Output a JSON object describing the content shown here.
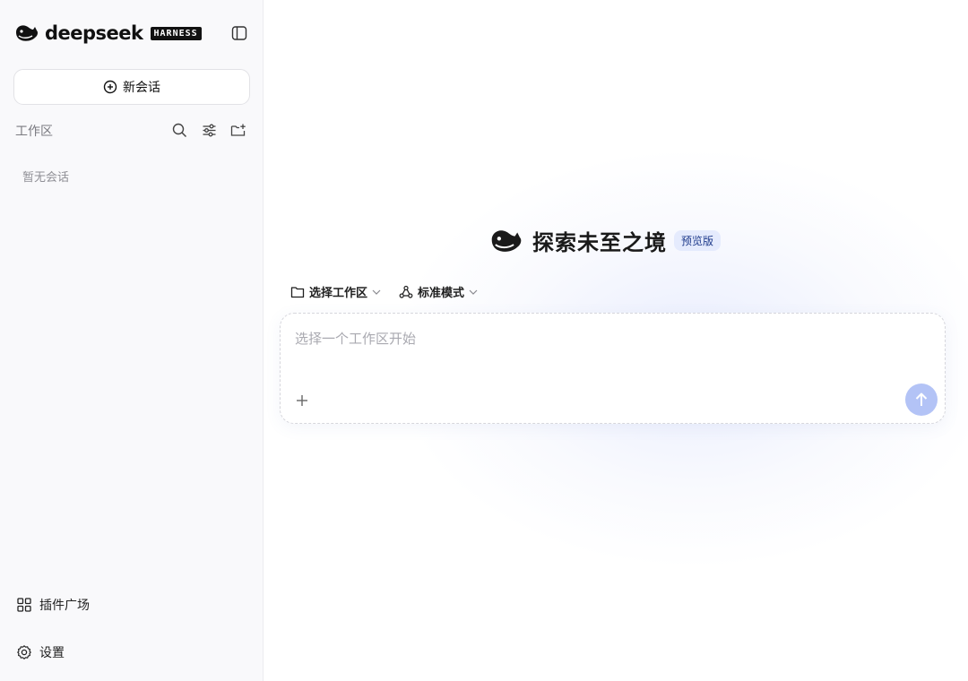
{
  "brand": {
    "name": "deepseek",
    "badge": "HARNESS"
  },
  "sidebar": {
    "new_chat_label": "新会话",
    "workspace_title": "工作区",
    "empty_text": "暂无会话",
    "bottom": [
      {
        "label": "插件广场",
        "icon": "grid-icon"
      },
      {
        "label": "设置",
        "icon": "gear-icon"
      }
    ]
  },
  "main": {
    "hero_title": "探索未至之境",
    "hero_badge": "预览版",
    "workspace_selector": "选择工作区",
    "mode_selector": "标准模式",
    "composer_placeholder": "选择一个工作区开始"
  },
  "colors": {
    "accent_send": "#b3c3f6",
    "badge_bg": "#e5ebfd",
    "sidebar_bg": "#f9f9fb"
  }
}
